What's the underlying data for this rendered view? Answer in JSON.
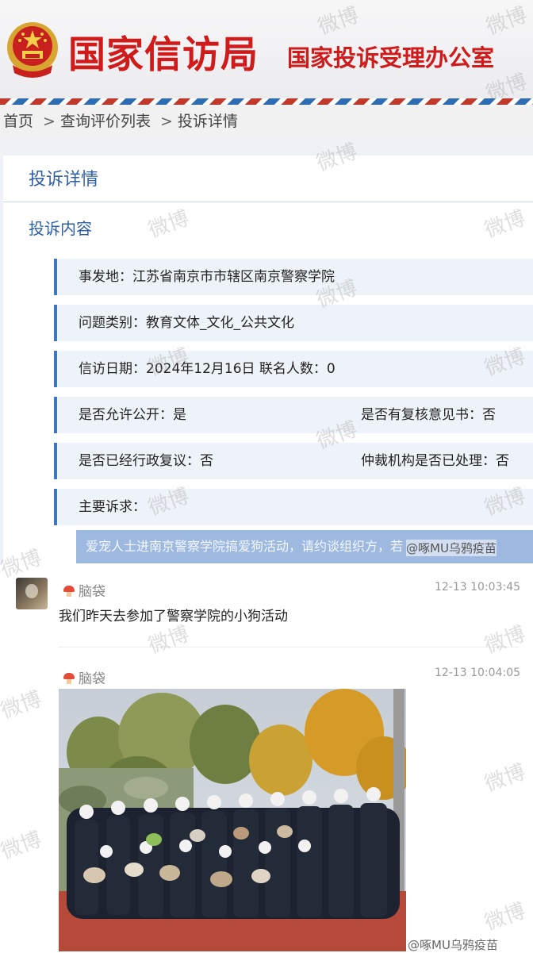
{
  "header": {
    "title": "国家信访局",
    "subtitle": "国家投诉受理办公室"
  },
  "breadcrumb": {
    "items": [
      "首页",
      "查询评价列表",
      "投诉详情"
    ],
    "separator": ">"
  },
  "detail": {
    "card_title": "投诉详情",
    "section_title": "投诉内容",
    "rows": [
      {
        "left": "事发地：江苏省南京市市辖区南京警察学院",
        "right": ""
      },
      {
        "left": "问题类别：教育文体_文化_公共文化",
        "right": ""
      },
      {
        "left": "信访日期：2024年12月16日 联名人数：0",
        "right": ""
      },
      {
        "left": "是否允许公开：是",
        "right": "是否有复核意见书：否"
      },
      {
        "left": "是否已经行政复议：否",
        "right": "仲裁机构是否已处理：否"
      },
      {
        "left": "主要诉求：",
        "right": ""
      }
    ],
    "claim": "爱宠人士进南京警察学院搞爱狗活动，请约谈组织方，若"
  },
  "watermarks": {
    "text": "微博",
    "handle_top": "@啄MU乌鸦疫苗",
    "handle_bottom": "@啄MU乌鸦疫苗"
  },
  "comments": [
    {
      "user": "脑袋",
      "time": "12-13 10:03:45",
      "text": "我们昨天去参加了警察学院的小狗活动"
    },
    {
      "user": "脑袋",
      "time": "12-13 10:04:05",
      "text": ""
    }
  ],
  "colors": {
    "brand_red": "#d11b1b",
    "accent_blue": "#2f5fa7",
    "row_border": "#3b78c4",
    "claim_bg": "#9db9e0"
  }
}
